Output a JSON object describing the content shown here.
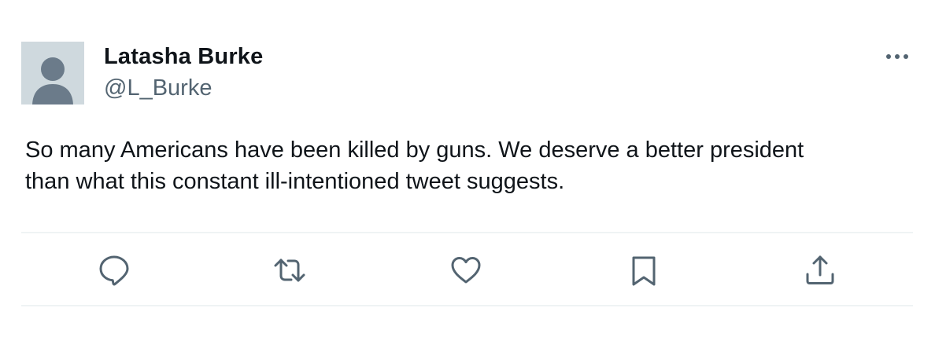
{
  "author": {
    "display_name": "Latasha Burke",
    "handle": "@L_Burke",
    "avatar_icon": "default-avatar-icon"
  },
  "tweet": {
    "text_lines": [
      "So many Americans have been killed by guns. We deserve a better president",
      "than what this constant ill-intentioned tweet suggests."
    ]
  },
  "actions": [
    {
      "name": "reply",
      "icon": "reply-icon"
    },
    {
      "name": "retweet",
      "icon": "retweet-icon"
    },
    {
      "name": "like",
      "icon": "heart-icon"
    },
    {
      "name": "bookmark",
      "icon": "bookmark-icon"
    },
    {
      "name": "share",
      "icon": "share-icon"
    }
  ],
  "menu": {
    "icon": "more-icon"
  },
  "colors": {
    "text": "#0f1419",
    "secondary_text": "#536471",
    "avatar_bg": "#cfd9de",
    "avatar_figure": "#6b7b8a",
    "divider": "#eff3f4"
  }
}
